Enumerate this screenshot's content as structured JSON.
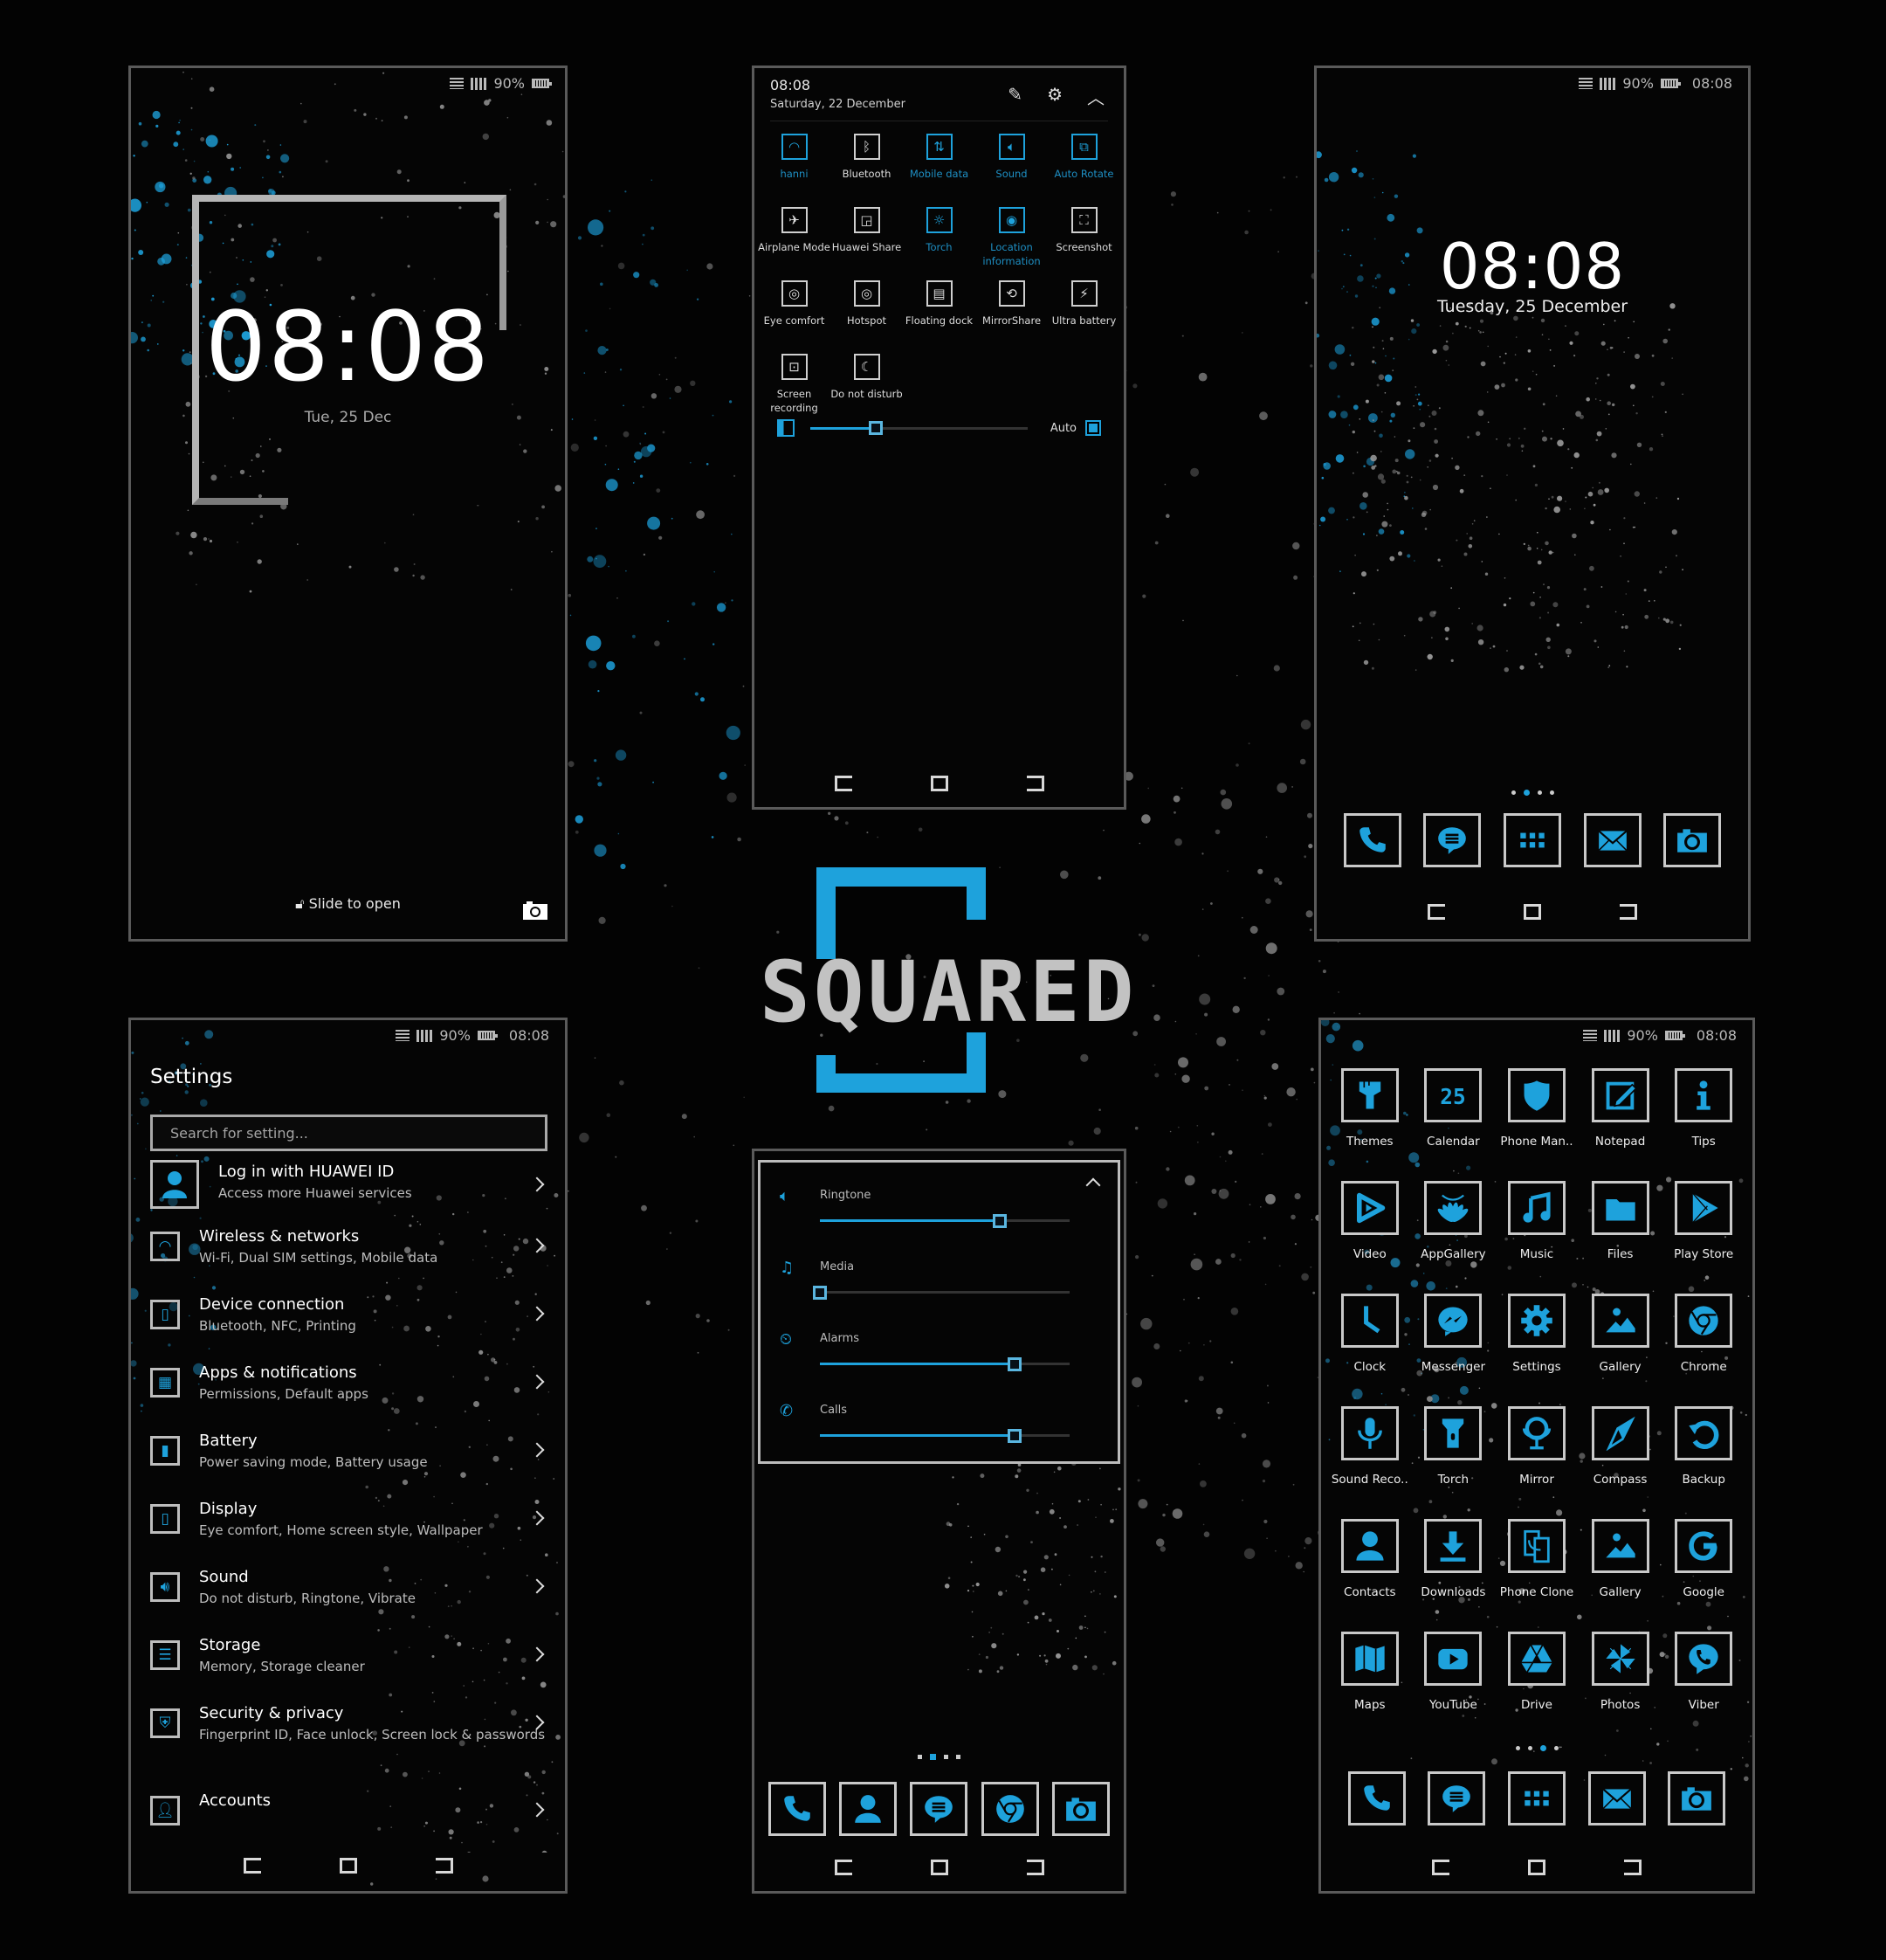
{
  "theme": {
    "accent": "#1ea2dc",
    "frame": "#c9c9c9",
    "background": "#030303"
  },
  "status_bar": {
    "battery": "90%",
    "time": "08:08"
  },
  "brand": {
    "logo_text": "SQUARED"
  },
  "lock_screen": {
    "time": "08:08",
    "date": "Tue, 25 Dec",
    "unlock_hint": "Slide to open",
    "battery": "90%"
  },
  "quick_settings": {
    "time": "08:08",
    "date": "Saturday, 22 December",
    "tiles": [
      {
        "label": "hanni",
        "icon": "wifi-icon",
        "active": true
      },
      {
        "label": "Bluetooth",
        "icon": "bluetooth-icon",
        "active": false
      },
      {
        "label": "Mobile data",
        "icon": "mobile-data-icon",
        "active": true
      },
      {
        "label": "Sound",
        "icon": "sound-icon",
        "active": true
      },
      {
        "label": "Auto Rotate",
        "icon": "auto-rotate-icon",
        "active": true
      },
      {
        "label": "Airplane Mode",
        "icon": "airplane-icon",
        "active": false
      },
      {
        "label": "Huawei Share",
        "icon": "huawei-share-icon",
        "active": false
      },
      {
        "label": "Torch",
        "icon": "torch-icon",
        "active": true
      },
      {
        "label": "Location information",
        "icon": "location-icon",
        "active": true
      },
      {
        "label": "Screenshot",
        "icon": "screenshot-icon",
        "active": false
      },
      {
        "label": "Eye comfort",
        "icon": "eye-icon",
        "active": false
      },
      {
        "label": "Hotspot",
        "icon": "hotspot-icon",
        "active": false
      },
      {
        "label": "Floating dock",
        "icon": "floating-dock-icon",
        "active": false
      },
      {
        "label": "MirrorShare",
        "icon": "mirrorshare-icon",
        "active": false
      },
      {
        "label": "Ultra battery",
        "icon": "ultra-battery-icon",
        "active": false
      },
      {
        "label": "Screen recording",
        "icon": "screen-recording-icon",
        "active": false
      },
      {
        "label": "Do not disturb",
        "icon": "moon-icon",
        "active": false
      }
    ],
    "brightness": {
      "value_percent": 30,
      "auto_label": "Auto",
      "auto_on": true
    }
  },
  "home_screen": {
    "time": "08:08",
    "date": "Tuesday, 25 December",
    "page_indicator": {
      "pages": 4,
      "current": 2
    },
    "dock": [
      {
        "name": "Phone",
        "icon": "phone-icon"
      },
      {
        "name": "Messages",
        "icon": "message-icon"
      },
      {
        "name": "Apps",
        "icon": "app-grid-icon"
      },
      {
        "name": "Email",
        "icon": "mail-icon"
      },
      {
        "name": "Camera",
        "icon": "camera-icon"
      }
    ]
  },
  "settings": {
    "title": "Settings",
    "search_placeholder": "Search for setting...",
    "account": {
      "title": "Log in with HUAWEI ID",
      "subtitle": "Access more Huawei services"
    },
    "items": [
      {
        "title": "Wireless & networks",
        "subtitle": "Wi-Fi, Dual SIM settings, Mobile data",
        "icon": "wifi-icon"
      },
      {
        "title": "Device connection",
        "subtitle": "Bluetooth, NFC, Printing",
        "icon": "device-connection-icon"
      },
      {
        "title": "Apps & notifications",
        "subtitle": "Permissions, Default apps",
        "icon": "apps-icon"
      },
      {
        "title": "Battery",
        "subtitle": "Power saving mode, Battery usage",
        "icon": "battery-icon"
      },
      {
        "title": "Display",
        "subtitle": "Eye comfort, Home screen style, Wallpaper",
        "icon": "display-icon"
      },
      {
        "title": "Sound",
        "subtitle": "Do not disturb, Ringtone, Vibrate",
        "icon": "sound-icon"
      },
      {
        "title": "Storage",
        "subtitle": "Memory, Storage cleaner",
        "icon": "storage-icon"
      },
      {
        "title": "Security & privacy",
        "subtitle": "Fingerprint ID, Face unlock, Screen lock & passwords",
        "icon": "shield-icon"
      },
      {
        "title": "Accounts",
        "subtitle": "",
        "icon": "account-icon"
      }
    ]
  },
  "volume_panel": {
    "rows": [
      {
        "label": "Ringtone",
        "icon": "speaker-icon",
        "value_percent": 72
      },
      {
        "label": "Media",
        "icon": "music-note-icon",
        "value_percent": 0
      },
      {
        "label": "Alarms",
        "icon": "alarm-icon",
        "value_percent": 78
      },
      {
        "label": "Calls",
        "icon": "phone-icon",
        "value_percent": 78
      }
    ],
    "page_indicator": {
      "pages": 4,
      "current": 2
    },
    "dock": [
      {
        "name": "Phone",
        "icon": "phone-icon"
      },
      {
        "name": "Contacts",
        "icon": "contact-icon"
      },
      {
        "name": "Messages",
        "icon": "message-icon"
      },
      {
        "name": "Chrome",
        "icon": "chrome-icon"
      },
      {
        "name": "Camera",
        "icon": "camera-icon"
      }
    ]
  },
  "app_drawer": {
    "apps": [
      {
        "label": "Themes",
        "icon": "brush-icon"
      },
      {
        "label": "Calendar",
        "icon": "calendar-icon",
        "badge": "25"
      },
      {
        "label": "Phone Man..",
        "icon": "shield-icon"
      },
      {
        "label": "Notepad",
        "icon": "notepad-icon"
      },
      {
        "label": "Tips",
        "icon": "info-icon"
      },
      {
        "label": "Video",
        "icon": "video-play-icon"
      },
      {
        "label": "AppGallery",
        "icon": "huawei-logo-icon"
      },
      {
        "label": "Music",
        "icon": "music-note-icon"
      },
      {
        "label": "Files",
        "icon": "folder-icon"
      },
      {
        "label": "Play Store",
        "icon": "play-store-icon"
      },
      {
        "label": "Clock",
        "icon": "clock-icon"
      },
      {
        "label": "Messenger",
        "icon": "messenger-icon"
      },
      {
        "label": "Settings",
        "icon": "gear-icon"
      },
      {
        "label": "Gallery",
        "icon": "image-icon"
      },
      {
        "label": "Chrome",
        "icon": "chrome-icon"
      },
      {
        "label": "Sound Reco..",
        "icon": "microphone-icon"
      },
      {
        "label": "Torch",
        "icon": "flashlight-icon"
      },
      {
        "label": "Mirror",
        "icon": "mirror-icon"
      },
      {
        "label": "Compass",
        "icon": "compass-icon"
      },
      {
        "label": "Backup",
        "icon": "backup-icon"
      },
      {
        "label": "Contacts",
        "icon": "contact-icon"
      },
      {
        "label": "Downloads",
        "icon": "download-icon"
      },
      {
        "label": "Phone Clone",
        "icon": "phone-clone-icon"
      },
      {
        "label": "Gallery",
        "icon": "image-icon"
      },
      {
        "label": "Google",
        "icon": "google-icon"
      },
      {
        "label": "Maps",
        "icon": "map-icon"
      },
      {
        "label": "YouTube",
        "icon": "youtube-icon"
      },
      {
        "label": "Drive",
        "icon": "drive-icon"
      },
      {
        "label": "Photos",
        "icon": "pinwheel-icon"
      },
      {
        "label": "Viber",
        "icon": "viber-icon"
      }
    ],
    "page_indicator": {
      "pages": 4,
      "current": 3
    },
    "dock": [
      {
        "name": "Phone",
        "icon": "phone-icon"
      },
      {
        "name": "Messages",
        "icon": "message-icon"
      },
      {
        "name": "Apps",
        "icon": "app-grid-icon"
      },
      {
        "name": "Email",
        "icon": "mail-icon"
      },
      {
        "name": "Camera",
        "icon": "camera-icon"
      }
    ]
  }
}
